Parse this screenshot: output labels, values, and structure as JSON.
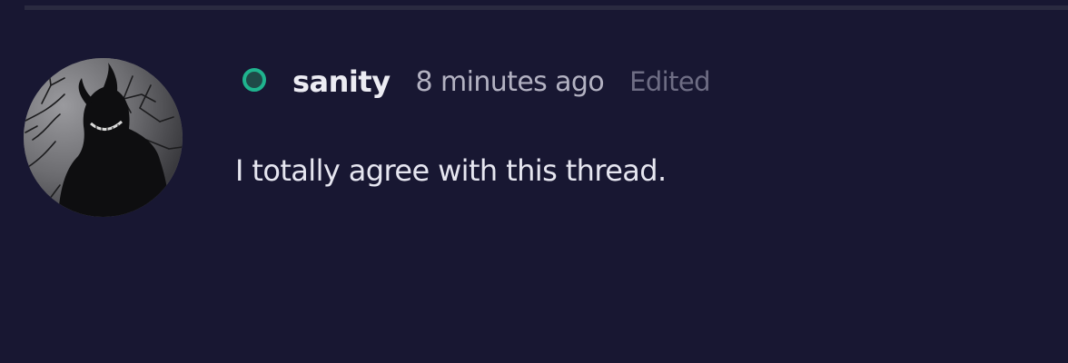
{
  "comment": {
    "author": {
      "username": "sanity",
      "status": "online",
      "status_color": "#1fb38e",
      "avatar_icon": "horned-figure-avatar"
    },
    "timestamp": "8 minutes ago",
    "edited_label": "Edited",
    "body": "I totally agree with this thread."
  },
  "theme": {
    "background": "#181732",
    "divider": "#2a2a40"
  }
}
